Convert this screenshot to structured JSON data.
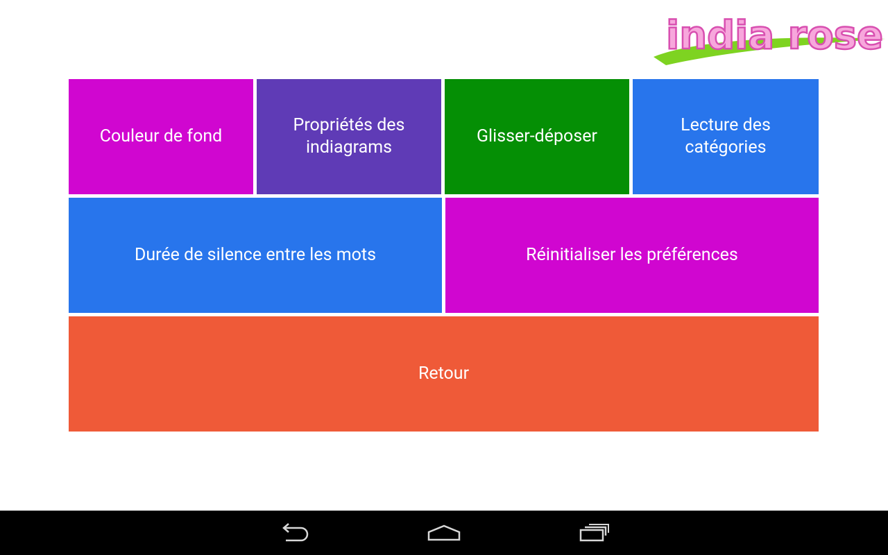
{
  "app": {
    "logo_text": "india rose",
    "logo_colors": {
      "text_fill": "#f7a7dc",
      "text_stroke": "#d84fb0",
      "swoosh": "#7ed321"
    }
  },
  "menu": {
    "tiles": [
      {
        "id": "background-color",
        "label_lines": [
          "Couleur de fond"
        ],
        "color": "#d006d0"
      },
      {
        "id": "indiagram-properties",
        "label_lines": [
          "Propriétés des",
          "indiagrams"
        ],
        "color": "#5f3bb6"
      },
      {
        "id": "drag-and-drop",
        "label_lines": [
          "Glisser-déposer"
        ],
        "color": "#058f05"
      },
      {
        "id": "category-reading",
        "label_lines": [
          "Lecture des",
          "catégories"
        ],
        "color": "#2875ec"
      },
      {
        "id": "silence-duration",
        "label_lines": [
          "Durée de silence entre les mots"
        ],
        "color": "#2875ec"
      },
      {
        "id": "reset-preferences",
        "label_lines": [
          "Réinitialiser les préférences"
        ],
        "color": "#d006d0"
      },
      {
        "id": "back",
        "label_lines": [
          "Retour"
        ],
        "color": "#ef5a38"
      }
    ]
  },
  "navbar": {
    "background": "#000000",
    "buttons": [
      {
        "icon": "back-arrow-icon"
      },
      {
        "icon": "home-icon"
      },
      {
        "icon": "recent-apps-icon"
      }
    ]
  }
}
